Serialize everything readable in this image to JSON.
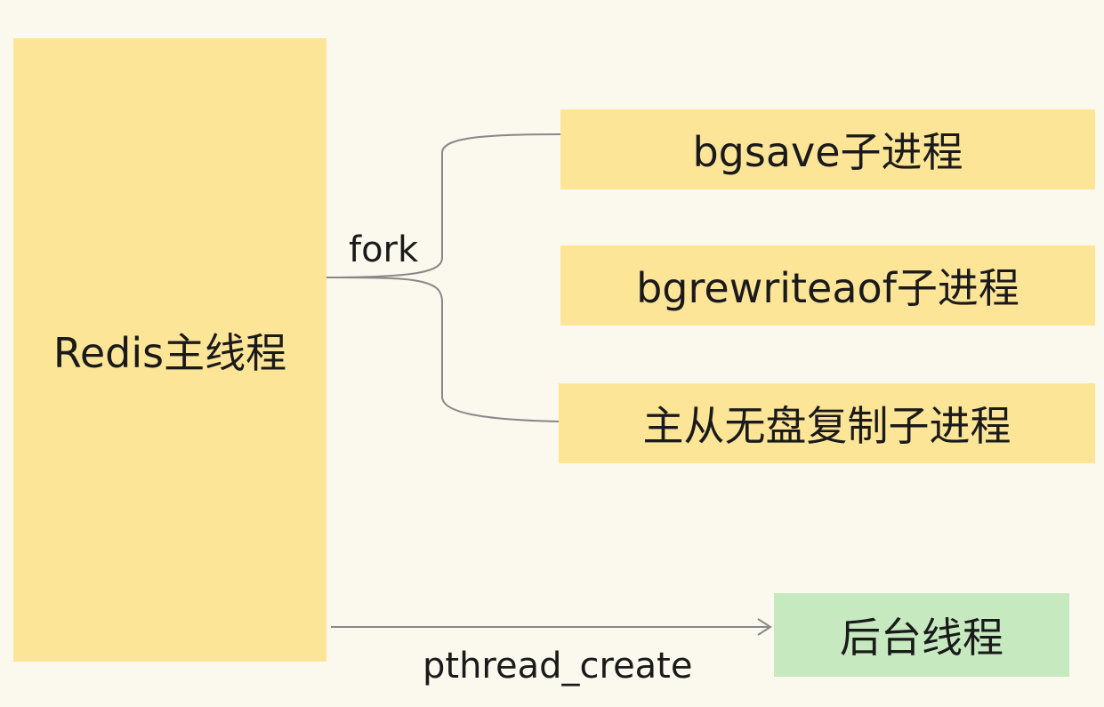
{
  "main_thread": {
    "label": "Redis主线程"
  },
  "fork_label": "fork",
  "child_processes": [
    {
      "label": "bgsave子进程"
    },
    {
      "label": "bgrewriteaof子进程"
    },
    {
      "label": "主从无盘复制子进程"
    }
  ],
  "background_thread": {
    "label": "后台线程"
  },
  "pthread_label": "pthread_create",
  "colors": {
    "background": "#fbf8ee",
    "process_box": "#fde598",
    "thread_box": "#c6e9c0",
    "connector": "#888888"
  }
}
